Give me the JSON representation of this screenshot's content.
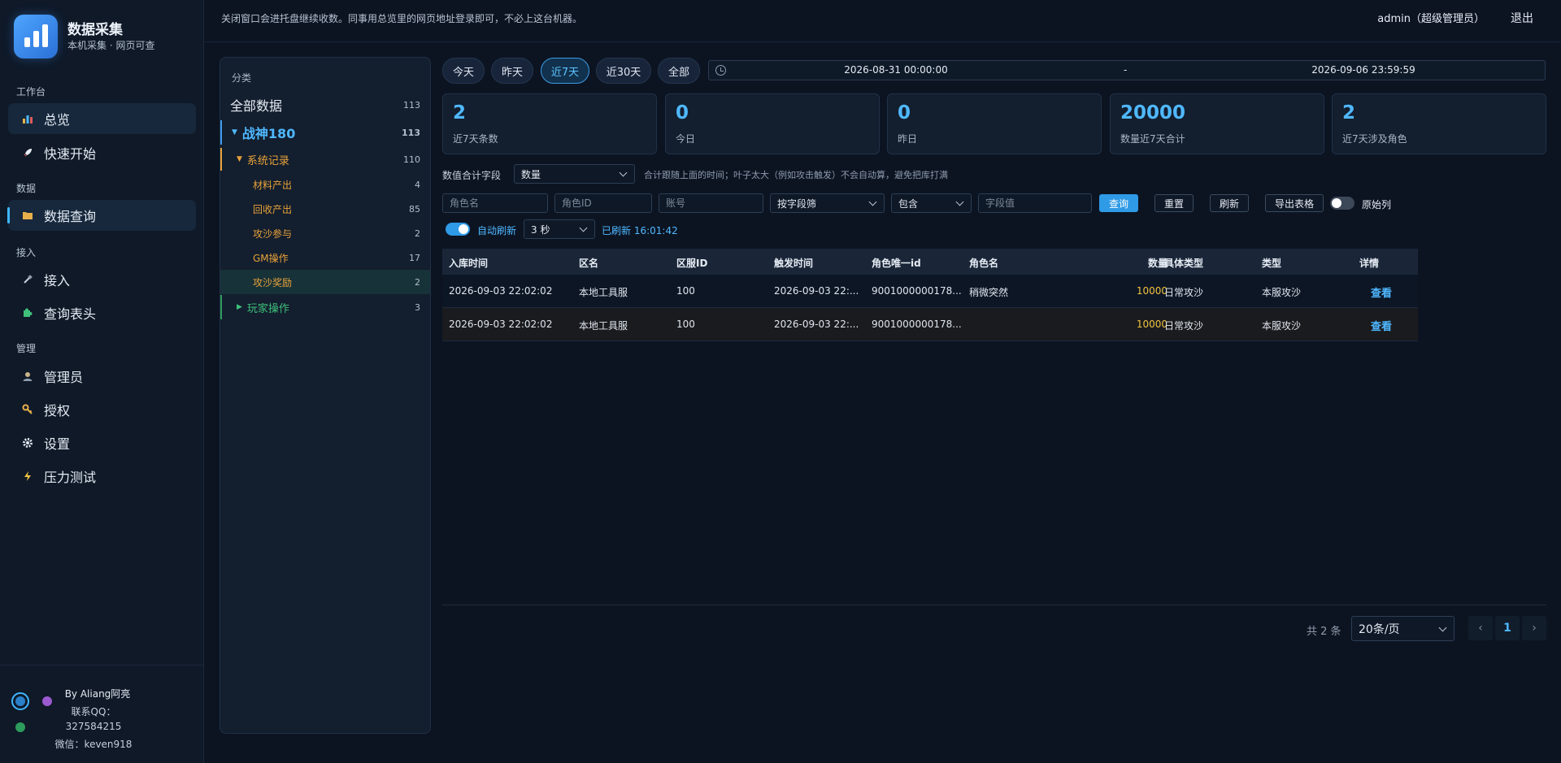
{
  "brand": {
    "title": "数据采集",
    "subtitle": "本机采集 · 网页可查"
  },
  "nav": {
    "groups": [
      "工作台",
      "数据",
      "接入",
      "管理"
    ],
    "items": [
      {
        "label": "总览",
        "icon": "bar-chart-icon"
      },
      {
        "label": "快速开始",
        "icon": "rocket-icon"
      },
      {
        "label": "数据查询",
        "icon": "folder-icon"
      },
      {
        "label": "接入",
        "icon": "plug-icon"
      },
      {
        "label": "查询表头",
        "icon": "puzzle-icon"
      },
      {
        "label": "管理员",
        "icon": "user-icon"
      },
      {
        "label": "授权",
        "icon": "key-icon"
      },
      {
        "label": "设置",
        "icon": "gear-icon"
      },
      {
        "label": "压力测试",
        "icon": "lightning-icon"
      }
    ]
  },
  "footer": {
    "by": "By Aliang阿亮",
    "qq_label": "联系QQ：",
    "qq": "327584215",
    "wechat": "微信：keven918"
  },
  "header": {
    "note": "关闭窗口会进托盘继续收数。同事用总览里的网页地址登录即可，不必上这台机器。",
    "user": "admin（超级管理员）",
    "logout": "退出"
  },
  "categories": {
    "title": "分类",
    "all": {
      "label": "全部数据",
      "count": "113"
    },
    "game": {
      "label": "战神180",
      "count": "113"
    },
    "system": {
      "label": "系统记录",
      "count": "110"
    },
    "subs": [
      {
        "label": "材料产出",
        "count": "4"
      },
      {
        "label": "回收产出",
        "count": "85"
      },
      {
        "label": "攻沙参与",
        "count": "2"
      },
      {
        "label": "GM操作",
        "count": "17"
      },
      {
        "label": "攻沙奖励",
        "count": "2"
      }
    ],
    "player": {
      "label": "玩家操作",
      "count": "3"
    }
  },
  "date_filters": [
    "今天",
    "昨天",
    "近7天",
    "近30天",
    "全部"
  ],
  "date_range": {
    "start": "2026-08-31 00:00:00",
    "sep": "-",
    "end": "2026-09-06 23:59:59"
  },
  "stats": [
    {
      "value": "2",
      "label": "近7天条数"
    },
    {
      "value": "0",
      "label": "今日"
    },
    {
      "value": "0",
      "label": "昨日"
    },
    {
      "value": "20000",
      "label": "数量近7天合计"
    },
    {
      "value": "2",
      "label": "近7天涉及角色"
    }
  ],
  "sum_field": {
    "label": "数值合计字段",
    "value": "数量",
    "hint": "合计跟随上面的时间；叶子太大（例如攻击触发）不会自动算，避免把库打满"
  },
  "filters": {
    "role_name_ph": "角色名",
    "role_id_ph": "角色ID",
    "account_ph": "账号",
    "field_filter": "按字段筛",
    "op": "包含",
    "field_value_ph": "字段值",
    "query": "查询",
    "reset": "重置",
    "refresh": "刷新",
    "export": "导出表格",
    "raw_label": "原始列"
  },
  "auto_refresh": {
    "label": "自动刷新",
    "interval": "3 秒",
    "status": "已刷新 16:01:42"
  },
  "table": {
    "headers": [
      "入库时间",
      "区名",
      "区服ID",
      "触发时间",
      "角色唯一id",
      "角色名",
      "数量",
      "具体类型",
      "类型",
      "详情"
    ],
    "rows": [
      [
        "2026-09-03 22:02:02",
        "本地工具服",
        "100",
        "2026-09-03 22:...",
        "9001000000178...",
        "稍微突然",
        "10000",
        "日常攻沙",
        "本服攻沙",
        "查看"
      ],
      [
        "2026-09-03 22:02:02",
        "本地工具服",
        "100",
        "2026-09-03 22:...",
        "9001000000178...",
        "",
        "10000",
        "日常攻沙",
        "本服攻沙",
        "查看"
      ]
    ]
  },
  "pagination": {
    "total": "共 2 条",
    "page_size": "20条/页",
    "current": "1",
    "prev": "‹",
    "next": "›"
  }
}
